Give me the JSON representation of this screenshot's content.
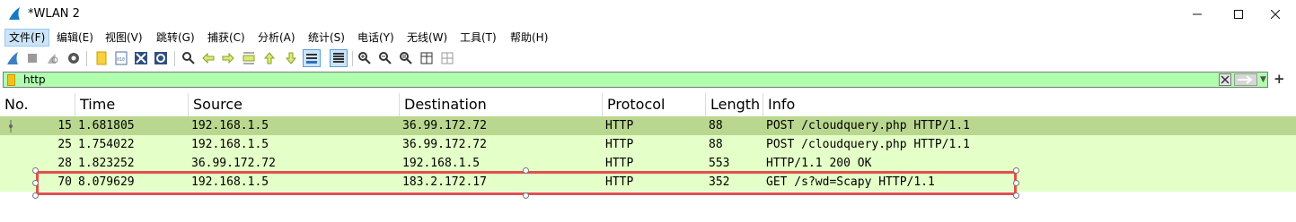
{
  "window": {
    "title": "*WLAN 2"
  },
  "menu": [
    {
      "label": "文件(F)"
    },
    {
      "label": "编辑(E)"
    },
    {
      "label": "视图(V)"
    },
    {
      "label": "跳转(G)"
    },
    {
      "label": "捕获(C)"
    },
    {
      "label": "分析(A)"
    },
    {
      "label": "统计(S)"
    },
    {
      "label": "电话(Y)"
    },
    {
      "label": "无线(W)"
    },
    {
      "label": "工具(T)"
    },
    {
      "label": "帮助(H)"
    }
  ],
  "filter": {
    "value": "http"
  },
  "columns": [
    "No.",
    "Time",
    "Source",
    "Destination",
    "Protocol",
    "Length",
    "Info"
  ],
  "packets": [
    {
      "no": "15",
      "time": "1.681805",
      "source": "192.168.1.5",
      "destination": "36.99.172.72",
      "protocol": "HTTP",
      "length": "88",
      "info": "POST /cloudquery.php HTTP/1.1"
    },
    {
      "no": "25",
      "time": "1.754022",
      "source": "192.168.1.5",
      "destination": "36.99.172.72",
      "protocol": "HTTP",
      "length": "88",
      "info": "POST /cloudquery.php HTTP/1.1"
    },
    {
      "no": "28",
      "time": "1.823252",
      "source": "36.99.172.72",
      "destination": "192.168.1.5",
      "protocol": "HTTP",
      "length": "553",
      "info": "HTTP/1.1 200 OK"
    },
    {
      "no": "70",
      "time": "8.079629",
      "source": "192.168.1.5",
      "destination": "183.2.172.17",
      "protocol": "HTTP",
      "length": "352",
      "info": "GET /s?wd=Scapy HTTP/1.1"
    }
  ],
  "colors": {
    "row_bg": "#e4ffc7",
    "selected_bg": "#bad78f",
    "filter_valid": "#afffaf",
    "annotation": "#e0504f"
  }
}
